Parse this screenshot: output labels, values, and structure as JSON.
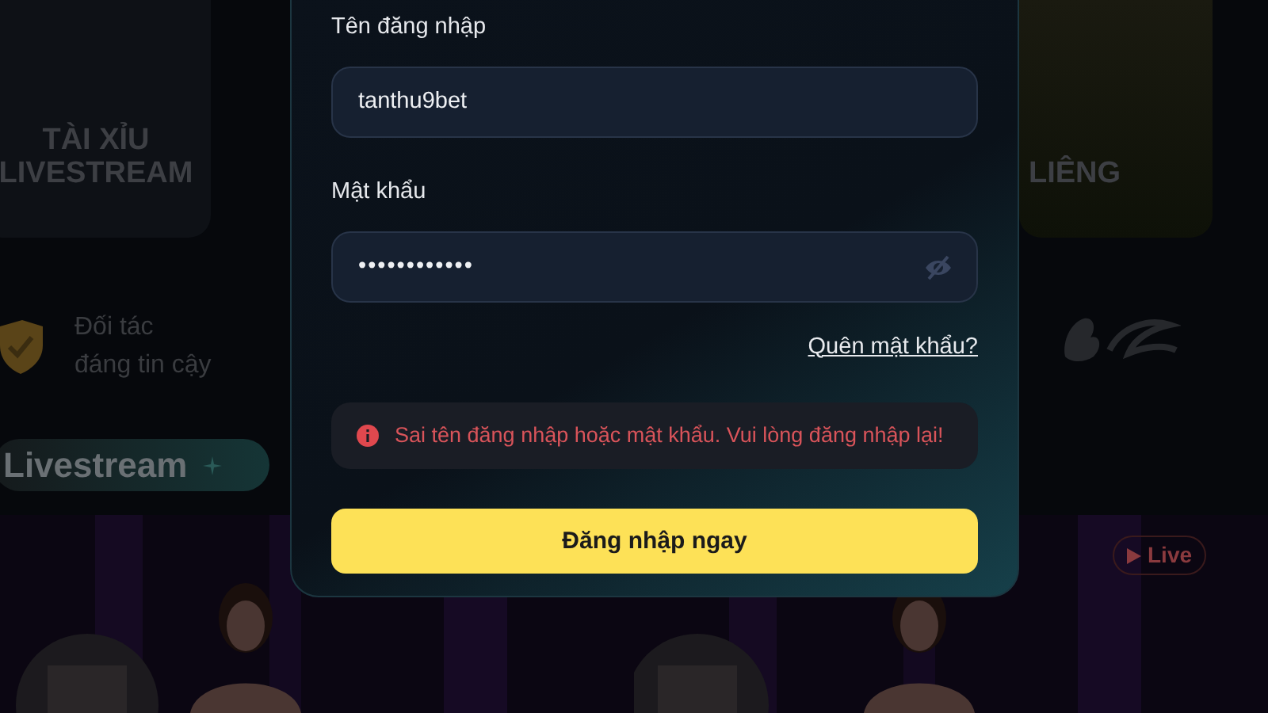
{
  "background": {
    "game_cards": [
      {
        "title_lines": [
          "TÀI XỈU",
          "LIVESTREAM"
        ]
      },
      {
        "title_lines": [
          "LIÊNG"
        ]
      }
    ],
    "trust_badge": {
      "text_lines": [
        "Đối tác",
        "đáng tin cậy"
      ]
    },
    "section_pill": {
      "label": "Livestream"
    },
    "live_badge": {
      "label": "Live"
    }
  },
  "login_form": {
    "username": {
      "label": "Tên đăng nhập",
      "value": "tanthu9bet"
    },
    "password": {
      "label": "Mật khẩu",
      "value": "••••••••••••"
    },
    "forgot_link": "Quên mật khẩu?",
    "error": "Sai tên đăng nhập hoặc mật khẩu. Vui lòng đăng nhập lại!",
    "submit": "Đăng nhập ngay"
  }
}
